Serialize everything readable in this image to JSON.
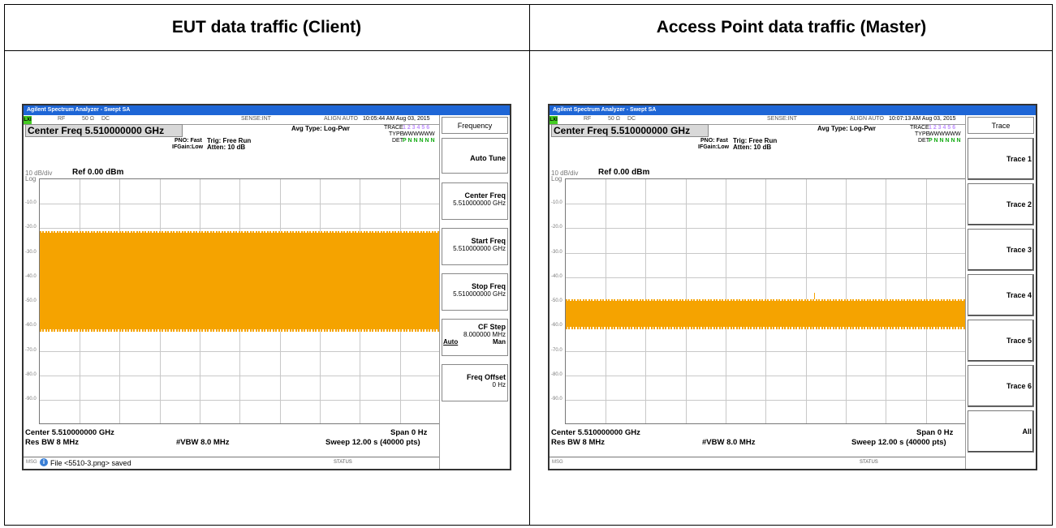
{
  "headers": {
    "left": "EUT data traffic (Client)",
    "right": "Access Point data traffic (Master)"
  },
  "colors": {
    "trace": "#f5a300",
    "titlebar": "#1e66d6"
  },
  "common": {
    "title": "Agilent Spectrum Analyzer - Swept SA",
    "lxi": "LXI",
    "rf": "RF",
    "ohm": "50 Ω",
    "dc": "DC",
    "sense": "SENSE:INT",
    "align": "ALIGN AUTO",
    "center_freq": "Center Freq 5.510000000 GHz",
    "pno": "PNO: Fast",
    "ifgain": "IFGain:Low",
    "trig": "Trig: Free Run",
    "atten": "Atten: 10 dB",
    "avg_type": "Avg Type: Log-Pwr",
    "trace_label": "TRACE",
    "trace_nums": "1 2 3 4 5 6",
    "type_label": "TYPE",
    "type_val": "WWWWWW",
    "det_label": "DET",
    "det_val": "P N N N N N",
    "scale": "10 dB/div",
    "log": "Log",
    "ref": "Ref 0.00 dBm",
    "y_labels": [
      "-10.0",
      "-20.0",
      "-30.0",
      "-40.0",
      "-50.0",
      "-60.0",
      "-70.0",
      "-80.0",
      "-90.0"
    ],
    "center": "Center 5.510000000 GHz",
    "span": "Span 0 Hz",
    "res_bw": "Res BW 8 MHz",
    "vbw": "#VBW 8.0 MHz",
    "sweep": "Sweep  12.00 s (40000 pts)",
    "msg": "MSG",
    "status": "STATUS"
  },
  "left_sa": {
    "timestamp": "10:05:44 AM Aug 03, 2015",
    "msg_text": "File <5510-3.png> saved",
    "softkey_menu": "Frequency",
    "softkeys": [
      {
        "label": "Auto Tune",
        "sub": ""
      },
      {
        "label": "Center Freq",
        "sub": "5.510000000 GHz"
      },
      {
        "label": "Start Freq",
        "sub": "5.510000000 GHz"
      },
      {
        "label": "Stop Freq",
        "sub": "5.510000000 GHz"
      },
      {
        "label": "CF Step",
        "sub": "8.000000 MHz"
      },
      {
        "label": "Freq Offset",
        "sub": "0 Hz"
      }
    ],
    "cf_auto": "Auto",
    "cf_man": "Man",
    "trace_band_dbm": [
      -22,
      -62
    ]
  },
  "right_sa": {
    "timestamp": "10:07:13 AM Aug 03, 2015",
    "softkey_menu": "Trace",
    "softkeys": [
      "Trace 1",
      "Trace 2",
      "Trace 3",
      "Trace 4",
      "Trace 5",
      "Trace 6",
      "All"
    ],
    "trace_band_dbm": [
      -50,
      -61
    ]
  }
}
